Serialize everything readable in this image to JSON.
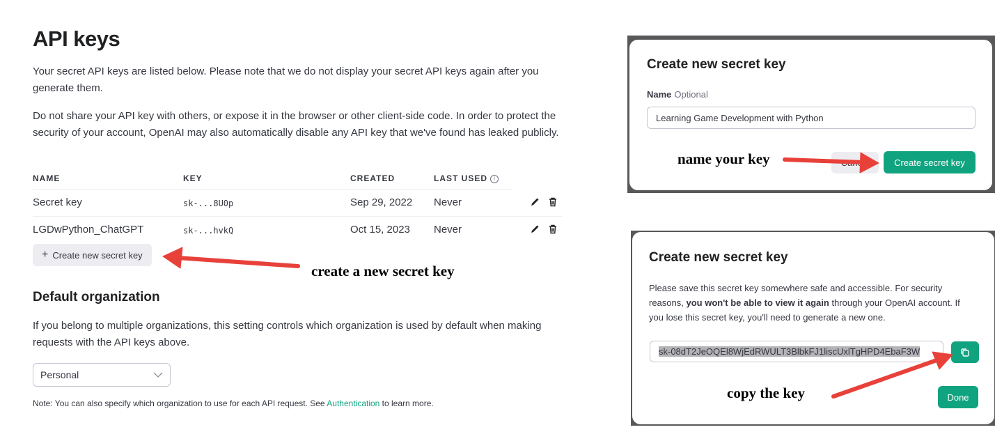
{
  "page": {
    "title": "API keys",
    "intro_1": "Your secret API keys are listed below. Please note that we do not display your secret API keys again after you generate them.",
    "intro_2": "Do not share your API key with others, or expose it in the browser or other client-side code. In order to protect the security of your account, OpenAI may also automatically disable any API key that we've found has leaked publicly."
  },
  "table": {
    "headers": {
      "name": "NAME",
      "key": "KEY",
      "created": "CREATED",
      "last_used": "LAST USED",
      "info_icon": "i"
    },
    "rows": [
      {
        "name": "Secret key",
        "key": "sk-...8U0p",
        "created": "Sep 29, 2022",
        "last_used": "Never"
      },
      {
        "name": "LGDwPython_ChatGPT",
        "key": "sk-...hvkQ",
        "created": "Oct 15, 2023",
        "last_used": "Never"
      }
    ],
    "row_icons": [
      "pencil-icon",
      "trash-icon"
    ]
  },
  "create_button": {
    "icon": "+",
    "label": "Create new secret key"
  },
  "default_org": {
    "title": "Default organization",
    "description": "If you belong to multiple organizations, this setting controls which organization is used by default when making requests with the API keys above.",
    "select_value": "Personal",
    "note_prefix": "Note: You can also specify which organization to use for each API request. See ",
    "note_link": "Authentication",
    "note_suffix": " to learn more."
  },
  "annotations": {
    "create": "create a new secret key",
    "name": "name your key",
    "copy": "copy the key"
  },
  "modal_name": {
    "title": "Create new secret key",
    "field_label": "Name",
    "field_optional": "Optional",
    "field_value": "Learning Game Development with Python",
    "cancel_label": "Cancel",
    "submit_label": "Create secret key"
  },
  "modal_copy": {
    "title": "Create new secret key",
    "message_1": "Please save this secret key somewhere safe and accessible. For security reasons, ",
    "message_bold": "you won't be able to view it again",
    "message_2": " through your OpenAI account. If you lose this secret key, you'll need to generate a new one.",
    "key_value": "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",
    "done_label": "Done"
  },
  "colors": {
    "accent": "#10a37f",
    "annotation_arrow": "#e8413a",
    "frame": "#58585a"
  }
}
